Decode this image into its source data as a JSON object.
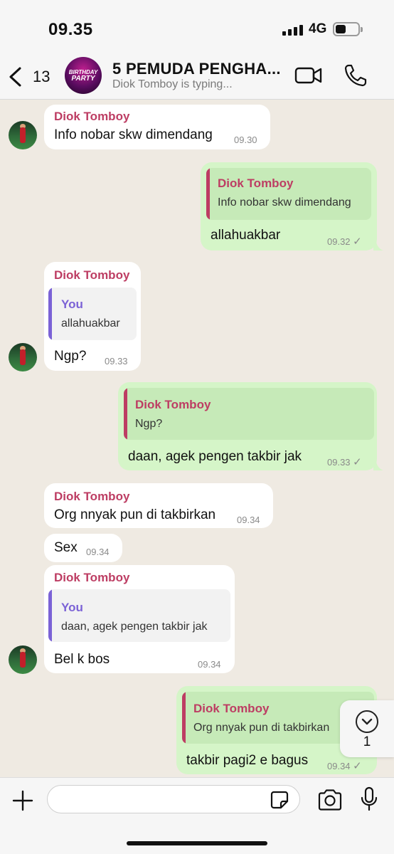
{
  "status_bar": {
    "time": "09.35",
    "network": "4G"
  },
  "header": {
    "back_count": "13",
    "avatar_text_line1": "BIRTHDAY",
    "avatar_text_line2": "PARTY",
    "title": "5 PEMUDA PENGHA...",
    "subtitle": "Diok Tomboy is typing..."
  },
  "messages": [
    {
      "dir": "in",
      "sender": "Diok Tomboy",
      "text": "Info nobar skw dimendang",
      "time": "09.30"
    },
    {
      "dir": "out",
      "quote_name": "Diok Tomboy",
      "quote_text": "Info nobar skw dimendang",
      "text": "allahuakbar",
      "time": "09.32",
      "status": "✓"
    },
    {
      "dir": "in",
      "sender": "Diok Tomboy",
      "quote_name": "You",
      "quote_text": "allahuakbar",
      "text": "Ngp?",
      "time": "09.33"
    },
    {
      "dir": "out",
      "quote_name": "Diok Tomboy",
      "quote_text": "Ngp?",
      "text": "daan, agek pengen takbir jak",
      "time": "09.33",
      "status": "✓"
    },
    {
      "dir": "in",
      "sender": "Diok Tomboy",
      "text": "Org nnyak pun di takbirkan",
      "time": "09.34"
    },
    {
      "dir": "in",
      "text": "Sex",
      "time": "09.34"
    },
    {
      "dir": "in",
      "sender": "Diok Tomboy",
      "quote_name": "You",
      "quote_text": "daan, agek pengen takbir jak",
      "text": "Bel k bos",
      "time": "09.34"
    },
    {
      "dir": "out",
      "quote_name": "Diok Tomboy",
      "quote_text": "Org nnyak pun di takbirkan",
      "text": "takbir pagi2 e bagus",
      "time": "09.34",
      "status": "✓"
    }
  ],
  "scroll_badge": "1",
  "input": {
    "placeholder": ""
  },
  "colors": {
    "incoming_bubble": "#ffffff",
    "outgoing_bubble": "#d5f5c8",
    "sender_name": "#bd3d63",
    "you_name": "#7b62d6",
    "background": "#efeae2"
  },
  "icons": [
    "back-chevron-icon",
    "video-call-icon",
    "phone-icon",
    "plus-icon",
    "sticker-icon",
    "camera-icon",
    "microphone-icon",
    "chevron-down-icon"
  ]
}
